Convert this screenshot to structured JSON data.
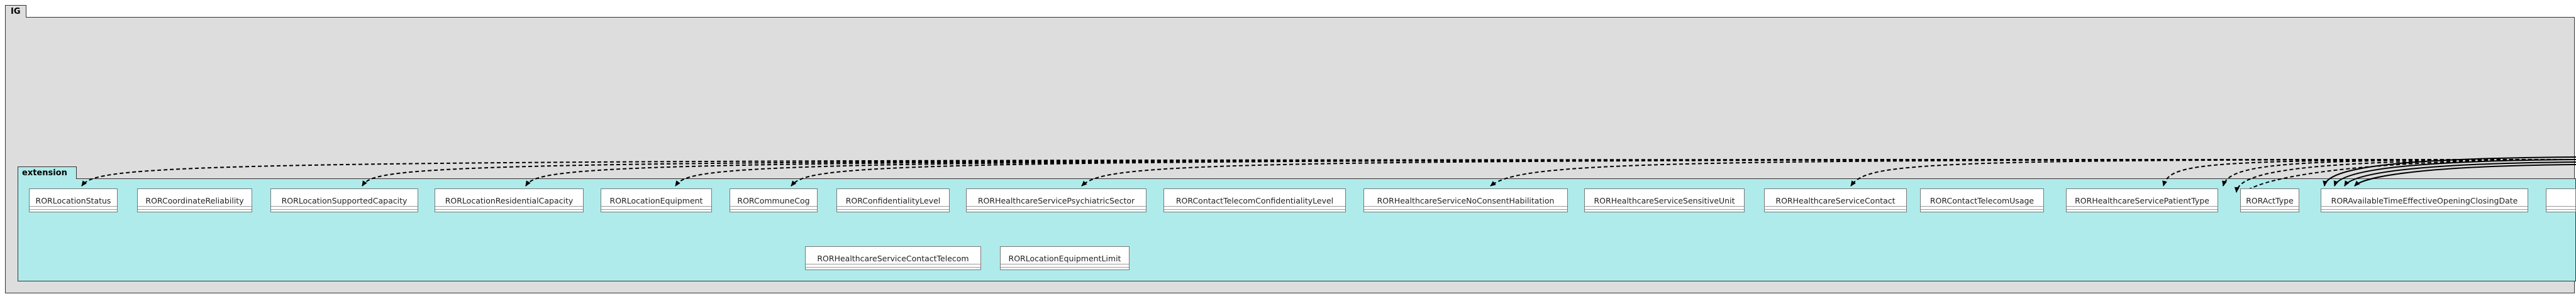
{
  "diagram": {
    "frame_label": "IG",
    "package_label": "extension",
    "classes": [
      {
        "key": "status",
        "label": "RORLocationStatus"
      },
      {
        "key": "coord",
        "label": "RORCoordinateReliability"
      },
      {
        "key": "supcap",
        "label": "RORLocationSupportedCapacity"
      },
      {
        "key": "rescap",
        "label": "RORLocationResidentialCapacity"
      },
      {
        "key": "equip",
        "label": "RORLocationEquipment"
      },
      {
        "key": "commune",
        "label": "RORCommuneCog"
      },
      {
        "key": "conf",
        "label": "RORConfidentialityLevel"
      },
      {
        "key": "psych",
        "label": "RORHealthcareServicePsychiatricSector"
      },
      {
        "key": "ctconf",
        "label": "RORContactTelecomConfidentialityLevel"
      },
      {
        "key": "nocons",
        "label": "RORHealthcareServiceNoConsentHabilitation"
      },
      {
        "key": "sens",
        "label": "RORHealthcareServiceSensitiveUnit"
      },
      {
        "key": "hcontact",
        "label": "RORHealthcareServiceContact"
      },
      {
        "key": "ctusage",
        "label": "RORContactTelecomUsage"
      },
      {
        "key": "ptype",
        "label": "RORHealthcareServicePatientType"
      },
      {
        "key": "acttype",
        "label": "RORActType"
      },
      {
        "key": "avail",
        "label": "RORAvailableTimeEffectiveOpeningClosingDate"
      },
      {
        "key": "hctel",
        "label": "RORHealthcareServiceContactTelecom"
      },
      {
        "key": "eqlimit",
        "label": "RORLocationEquipmentLimit"
      }
    ]
  }
}
